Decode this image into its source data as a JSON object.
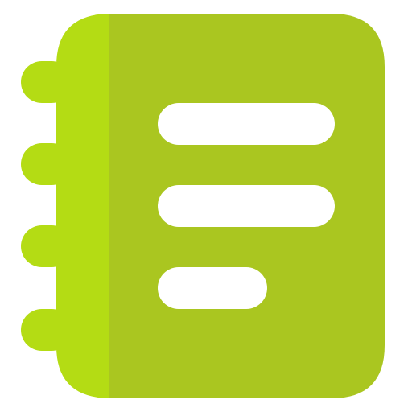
{
  "icon": {
    "name": "notebook-icon",
    "colors": {
      "spine": "#b4dc14",
      "cover": "#aac620",
      "lines": "#ffffff",
      "background": "#ffffff"
    }
  }
}
